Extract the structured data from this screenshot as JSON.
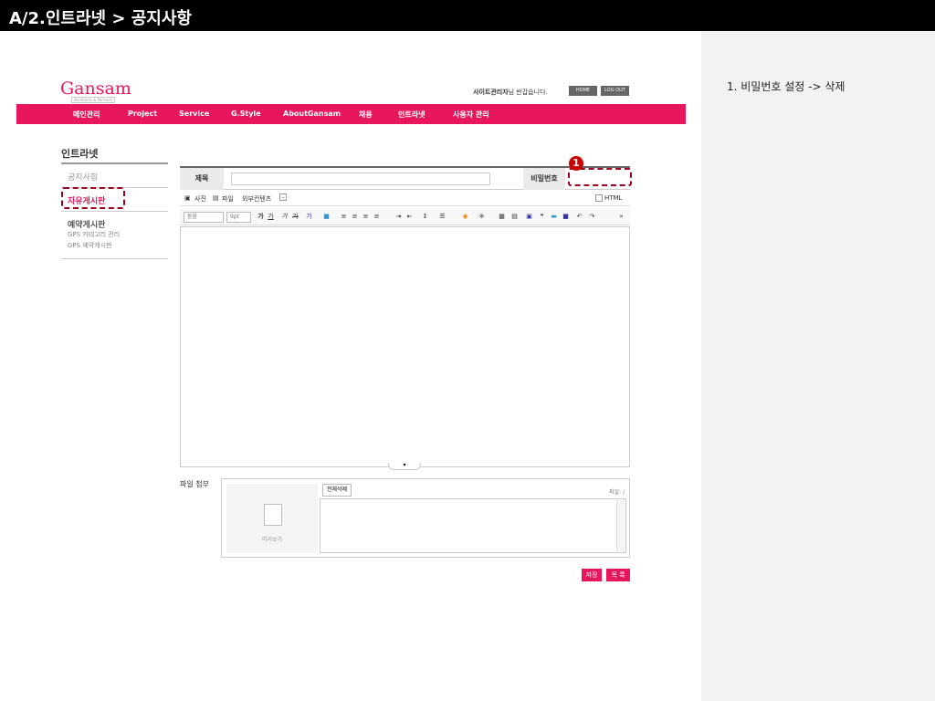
{
  "header": {
    "title": "A/2.인트라넷 > 공지사항"
  },
  "notes": {
    "item1": "1. 비밀번호 설정 -> 삭제"
  },
  "brand": {
    "logo": "Gansam",
    "logo_sub": "Architects & Partners"
  },
  "util": {
    "user": "사이트관리자",
    "greeting": "님 반갑습니다.",
    "home": "HOME",
    "logout": "LOG OUT"
  },
  "nav": {
    "items": [
      "메인관리",
      "Project",
      "Service",
      "G.Style",
      "AboutGansam",
      "채용",
      "인트라넷",
      "사용자 관리"
    ]
  },
  "sidebar": {
    "title": "인트라넷",
    "items": [
      "공지사항",
      "자유게시판",
      "예약게시판"
    ],
    "subitems": [
      "GPS 카테고리 관리",
      "GPS 예약게시판"
    ]
  },
  "form": {
    "title_label": "제목",
    "password_label": "비밀번호",
    "badge": "1",
    "attach_photo": "사진",
    "attach_file": "파일",
    "external": "외부컨텐츠",
    "html_label": "HTML",
    "font_select": "돋움",
    "size_select": "9pt"
  },
  "file": {
    "label": "파일 첨부",
    "delete_all": "전체삭제",
    "count": "파일: /",
    "preview": "미리보기"
  },
  "buttons": {
    "save": "저장",
    "list": "목 록"
  },
  "colors": {
    "brand": "#e8175d",
    "annotation": "#a0001a"
  }
}
